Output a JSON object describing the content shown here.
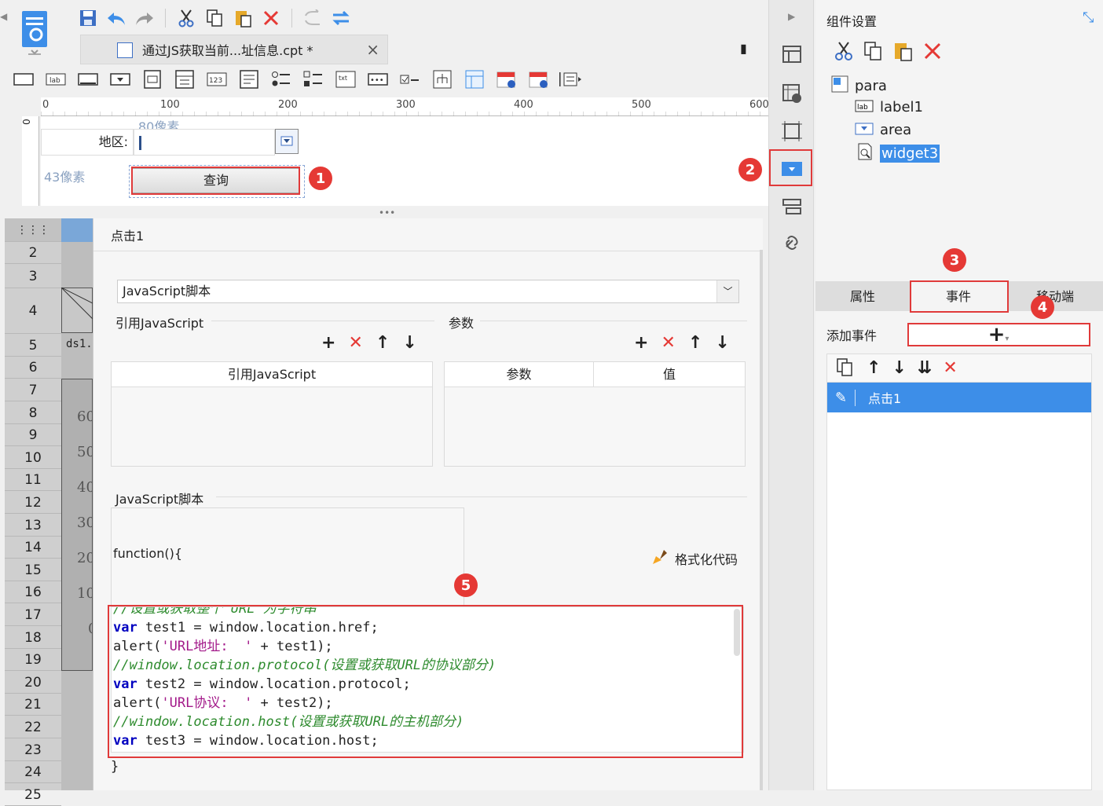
{
  "document_tab": {
    "title": "通过JS获取当前...址信息.cpt *"
  },
  "ruler": {
    "marks": [
      "0",
      "100",
      "200",
      "300",
      "400",
      "500",
      "600"
    ],
    "v_mark": "0"
  },
  "canvas": {
    "width_hint": "80像素",
    "height_hint": "43像素",
    "label_text": "地区:",
    "button_text": "查询"
  },
  "sheet": {
    "row_numbers": [
      "2",
      "3",
      "4",
      "5",
      "6",
      "7",
      "8",
      "9",
      "10",
      "11",
      "12",
      "13",
      "14",
      "15",
      "16",
      "17",
      "18",
      "19",
      "20",
      "21",
      "22",
      "23",
      "24",
      "25"
    ],
    "cell_ds": "ds1.",
    "y_values": [
      "60",
      "50",
      "40",
      "30",
      "20",
      "10",
      "0"
    ]
  },
  "event_dialog": {
    "title": "点击1",
    "type_select": "JavaScript脚本",
    "ref_js_section": "引用JavaScript",
    "params_section": "参数",
    "ref_js_col": "引用JavaScript",
    "params_col_name": "参数",
    "params_col_value": "值",
    "script_section": "JavaScript脚本",
    "func_header": "function(){",
    "format_code": "格式化代码",
    "closing": "}",
    "code_lines": [
      {
        "type": "comment",
        "text": "//设置或获取整个 URL 为字符串"
      },
      {
        "type": "code",
        "kw": "var",
        "text": " test1 = window.location.href;"
      },
      {
        "type": "alert",
        "pre": "alert(",
        "str": "'URL地址:  '",
        "post": " + test1);"
      },
      {
        "type": "comment",
        "text": "//window.location.protocol(设置或获取URL的协议部分)"
      },
      {
        "type": "code",
        "kw": "var",
        "text": " test2 = window.location.protocol;"
      },
      {
        "type": "alert",
        "pre": "alert(",
        "str": "'URL协议:  '",
        "post": " + test2);"
      },
      {
        "type": "comment",
        "text": "//window.location.host(设置或获取URL的主机部分)"
      },
      {
        "type": "code",
        "kw": "var",
        "text": " test3 = window.location.host;"
      }
    ]
  },
  "settings": {
    "title": "组件设置",
    "tree": {
      "root": "para",
      "items": [
        "label1",
        "area",
        "widget3"
      ]
    },
    "tabs": [
      "属性",
      "事件",
      "移动端"
    ],
    "add_event_label": "添加事件",
    "add_symbol": "+",
    "events": [
      "点击1"
    ]
  },
  "badges": [
    "1",
    "2",
    "3",
    "4",
    "5"
  ],
  "colors": {
    "accent": "#3d8ee8",
    "mark": "#e03a3a",
    "selected": "#3d8ee8",
    "delete": "#e53935"
  }
}
